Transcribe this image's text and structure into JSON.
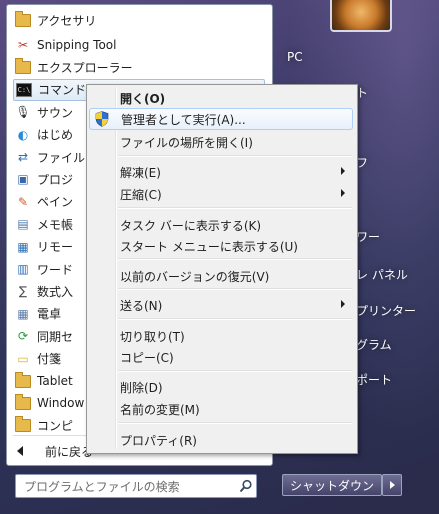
{
  "programs": {
    "folder_title": "アクセサリ",
    "items": [
      {
        "label": "Snipping Tool",
        "icon": "scissors-icon"
      },
      {
        "label": "エクスプローラー",
        "icon": "explorer-folder-icon"
      },
      {
        "label": "コマンド プロンプト",
        "icon": "command-prompt-icon"
      },
      {
        "label": "サウン",
        "icon": "microphone-icon"
      },
      {
        "label": "はじめ",
        "icon": "getting-started-icon"
      },
      {
        "label": "ファイル",
        "icon": "file-transfer-icon"
      },
      {
        "label": "プロジ",
        "icon": "projector-icon"
      },
      {
        "label": "ペイン",
        "icon": "paint-icon"
      },
      {
        "label": "メモ帳",
        "icon": "notepad-icon"
      },
      {
        "label": "リモー",
        "icon": "remote-desktop-icon"
      },
      {
        "label": "ワード",
        "icon": "wordpad-icon"
      },
      {
        "label": "数式入",
        "icon": "math-input-icon"
      },
      {
        "label": "電卓",
        "icon": "calculator-icon"
      },
      {
        "label": "同期セ",
        "icon": "sync-center-icon"
      },
      {
        "label": "付箋",
        "icon": "sticky-notes-icon"
      },
      {
        "label": "Tablet",
        "icon": "folder-icon"
      },
      {
        "label": "Window",
        "icon": "folder-icon"
      },
      {
        "label": "コンピ",
        "icon": "folder-icon"
      }
    ],
    "back_label": "前に戻る"
  },
  "search": {
    "placeholder": "プログラムとファイルの検索"
  },
  "right": {
    "items": [
      "PC",
      "ト",
      "フ",
      "ワー",
      "レ パネル",
      "プリンター",
      "グラム",
      "ポート"
    ],
    "shutdown_label": "シャットダウン"
  },
  "context_menu": {
    "items": [
      {
        "label": "開く(O)",
        "bold": true
      },
      {
        "label": "管理者として実行(A)...",
        "highlighted": true,
        "icon": "uac-shield-icon"
      },
      {
        "label": "ファイルの場所を開く(I)"
      },
      {
        "label": "解凍(E)",
        "submenu": true
      },
      {
        "label": "圧縮(C)",
        "submenu": true
      },
      {
        "label": "タスク バーに表示する(K)"
      },
      {
        "label": "スタート メニューに表示する(U)"
      },
      {
        "label": "以前のバージョンの復元(V)"
      },
      {
        "label": "送る(N)",
        "submenu": true
      },
      {
        "label": "切り取り(T)"
      },
      {
        "label": "コピー(C)"
      },
      {
        "label": "削除(D)"
      },
      {
        "label": "名前の変更(M)"
      },
      {
        "label": "プロパティ(R)"
      }
    ]
  },
  "colors": {
    "menu_bg": "#f0f0f0",
    "highlight_border": "#aecff7",
    "start_glass": "#3b3a66"
  }
}
